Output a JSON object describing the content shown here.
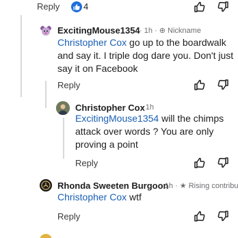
{
  "top": {
    "reply_label": "Reply",
    "reaction_count": "4"
  },
  "comments": [
    {
      "author": "ExcitingMouse1354",
      "time": "1h",
      "badge": "Nickname",
      "mention": "Christopher Cox",
      "text": " go up to the boardwalk and say it. I triple dog dare you. Don't just say it on Facebook",
      "reply_label": "Reply"
    },
    {
      "author": "Christopher Cox",
      "time": "1h",
      "mention": "ExcitingMouse1354",
      "text": " will the chimps attack over words ? You are only proving a point",
      "reply_label": "Reply"
    },
    {
      "author": "Rhonda Sweeten Burgoon",
      "time": "1h",
      "badge": "Rising contribut",
      "mention": "Christopher Cox",
      "text": " wtf",
      "reply_label": "Reply"
    }
  ],
  "icons": {
    "upvote": "thumbs-up-icon",
    "downvote": "thumbs-down-icon",
    "nickname": "globe-icon",
    "rising": "star-icon"
  },
  "colors": {
    "mention": "#1a5fb4",
    "badge": "#1e6fd9"
  }
}
